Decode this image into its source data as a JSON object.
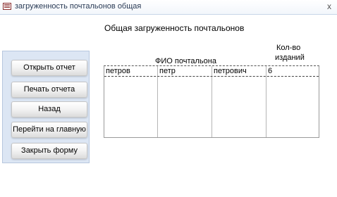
{
  "window": {
    "title": "загруженность почтальонов общая",
    "close_symbol": "x"
  },
  "form": {
    "heading": "Общая загруженность почтальонов"
  },
  "buttons": {
    "open_report": "Открыть отчет",
    "print_report": "Печать отчета",
    "back": "Назад",
    "go_home": "Перейти на главную",
    "close_form": "Закрыть форму"
  },
  "table": {
    "headers": {
      "fio": "ФИО почтальона",
      "count_line1": "Кол-во",
      "count_line2": "изданий"
    },
    "rows": [
      [
        "петров",
        "петр",
        "петрович",
        "6"
      ]
    ]
  }
}
